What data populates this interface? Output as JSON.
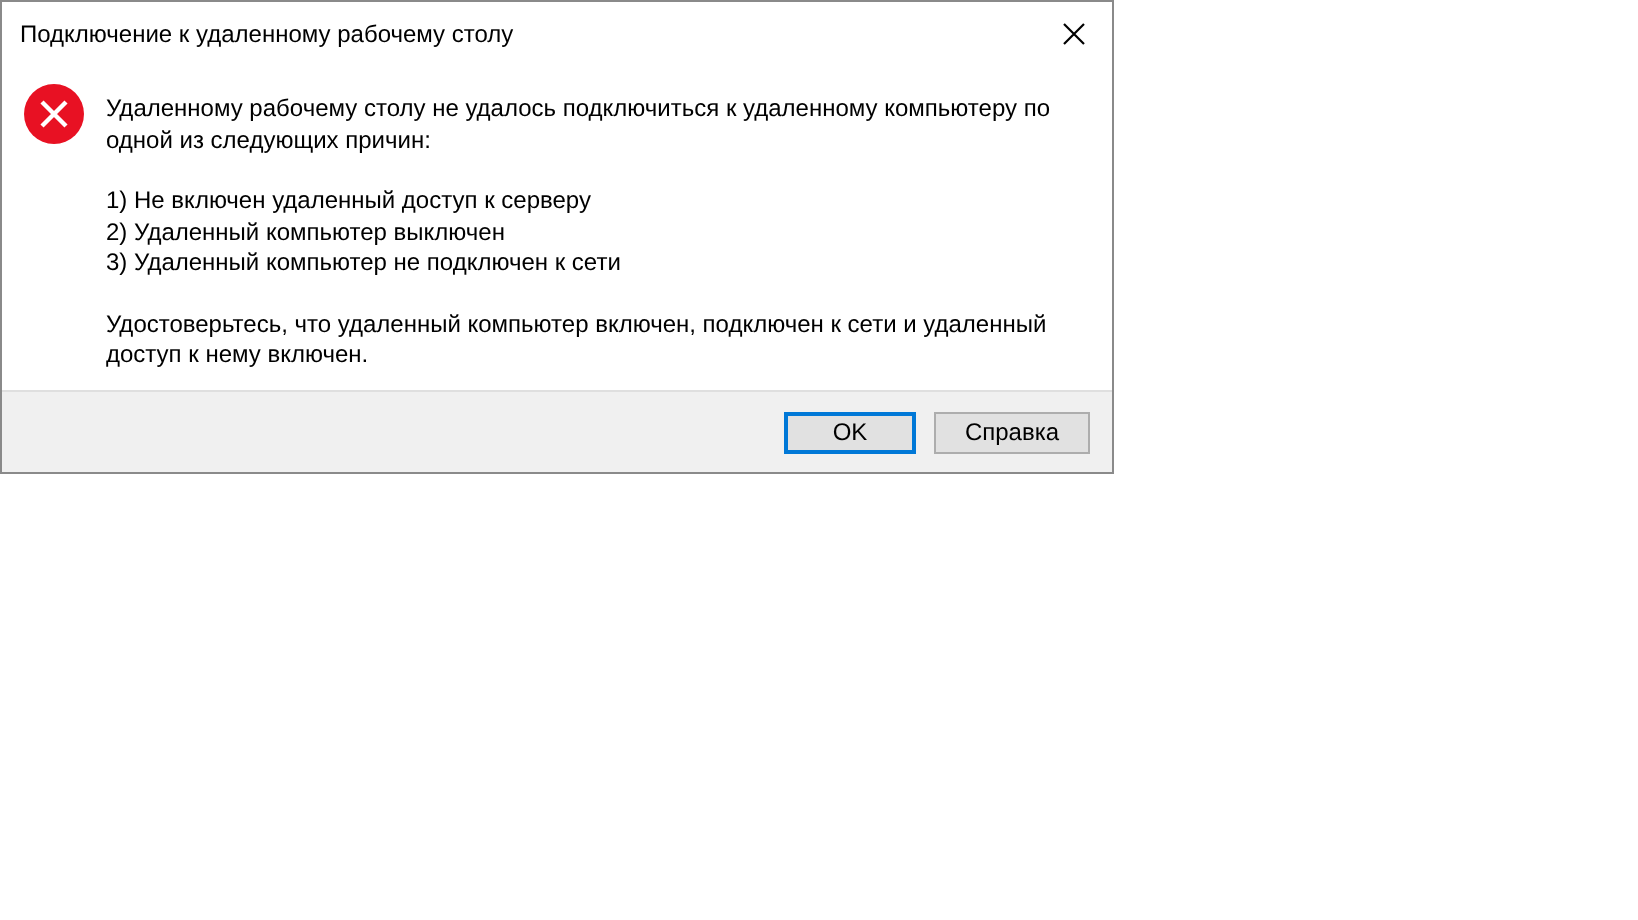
{
  "window": {
    "title": "Подключение к удаленному рабочему столу"
  },
  "message": "Удаленному рабочему столу не удалось подключиться к удаленному компьютеру по одной из следующих причин:",
  "reasons": [
    "1) Не включен удаленный доступ к серверу",
    "2) Удаленный компьютер выключен",
    "3) Удаленный компьютер не подключен к сети"
  ],
  "advice": "Удостоверьтесь, что удаленный компьютер включен, подключен к сети и удаленный доступ к нему включен.",
  "buttons": [
    {
      "label": "OK",
      "default": true
    },
    {
      "label": "Справка",
      "default": false
    }
  ]
}
